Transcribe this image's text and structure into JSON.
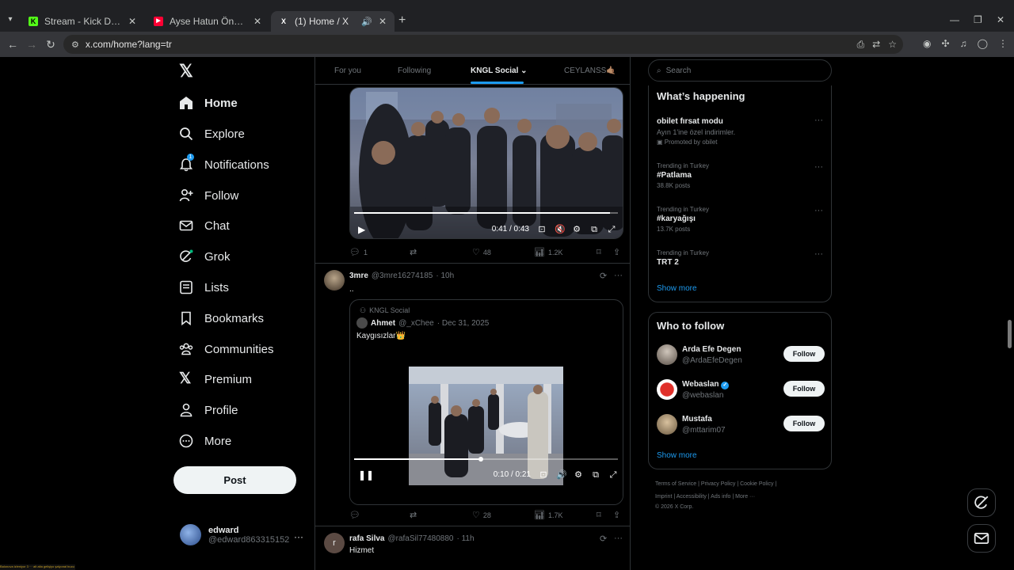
{
  "browser": {
    "tabs": [
      {
        "title": "Stream - Kick Dashboard",
        "favicon": "K",
        "color": "#53fc18"
      },
      {
        "title": "Ayse Hatun Önal - Olay - YouTube",
        "favicon": "▶",
        "color": "#ff0033"
      },
      {
        "title": "(1) Home / X",
        "favicon": "X",
        "color": "#ffffff",
        "active": true
      }
    ],
    "url": "x.com/home?lang=tr"
  },
  "nav": {
    "items": [
      {
        "label": "Home",
        "icon": "home-icon"
      },
      {
        "label": "Explore",
        "icon": "search-icon"
      },
      {
        "label": "Notifications",
        "icon": "bell-icon",
        "badge": "1"
      },
      {
        "label": "Follow",
        "icon": "add-person-icon"
      },
      {
        "label": "Chat",
        "icon": "envelope-icon"
      },
      {
        "label": "Grok",
        "icon": "grok-icon"
      },
      {
        "label": "Lists",
        "icon": "list-icon"
      },
      {
        "label": "Bookmarks",
        "icon": "bookmark-icon"
      },
      {
        "label": "Communities",
        "icon": "people-icon"
      },
      {
        "label": "Premium",
        "icon": "x-icon"
      },
      {
        "label": "Profile",
        "icon": "person-icon"
      },
      {
        "label": "More",
        "icon": "more-circle-icon"
      }
    ],
    "post_label": "Post",
    "account": {
      "name": "edward",
      "handle": "@edward863315152"
    }
  },
  "feed": {
    "tabs": [
      "For you",
      "Following",
      "KNGL Social",
      "CEYLANSS🤙🏽"
    ],
    "video1": {
      "time": "0:41 / 0:43",
      "progress": 0.97,
      "stats": {
        "replies": "1",
        "reposts": "",
        "likes": "48",
        "views": "1.2K"
      }
    },
    "tweet2": {
      "name": "3mre",
      "handle": "@3mre16274185",
      "time": "· 10h",
      "text": "..",
      "quote": {
        "community": "KNGL Social",
        "name": "Ahmet",
        "handle": "@_xChee",
        "date": "· Dec 31, 2025",
        "text": "Kaygısızlar👑"
      },
      "video_time": "0:10 / 0:21",
      "progress": 0.48,
      "stats": {
        "replies": "",
        "reposts": "",
        "likes": "28",
        "views": "1.7K"
      }
    },
    "tweet3": {
      "name": "rafa Silva",
      "handle": "@rafaSil77480880",
      "time": "· 11h",
      "text": "Hizmet",
      "avatar_letter": "r"
    }
  },
  "sidebar": {
    "search_placeholder": "Search",
    "happening_title": "What’s happening",
    "trends": [
      {
        "context": "",
        "title": "obilet fırsat modu",
        "sub": "Ayın 1'ine özel indirimler.",
        "promo": "Promoted by obilet"
      },
      {
        "context": "Trending in Turkey",
        "title": "#Patlama",
        "sub": "38.8K posts"
      },
      {
        "context": "Trending in Turkey",
        "title": "#karyağışı",
        "sub": "13.7K posts"
      },
      {
        "context": "Trending in Turkey",
        "title": "TRT 2",
        "sub": ""
      }
    ],
    "show_more": "Show more",
    "who_title": "Who to follow",
    "who": [
      {
        "name": "Arda Efe Degen",
        "handle": "@ArdaEfeDegen",
        "follow": "Follow"
      },
      {
        "name": "Webaslan",
        "handle": "@webaslan",
        "follow": "Follow",
        "verified": true
      },
      {
        "name": "Mustafa",
        "handle": "@mttarim07",
        "follow": "Follow"
      }
    ],
    "footer_line1": "Terms of Service  |  Privacy Policy  |  Cookie Policy  |",
    "footer_line2": "Imprint  |  Accessibility  |  Ads info  |  More ···",
    "footer_line3": "© 2026 X Corp."
  },
  "status_text": "Balonova izleniyor 3 ··· alt alta gelişiyo şalyonal bucu"
}
